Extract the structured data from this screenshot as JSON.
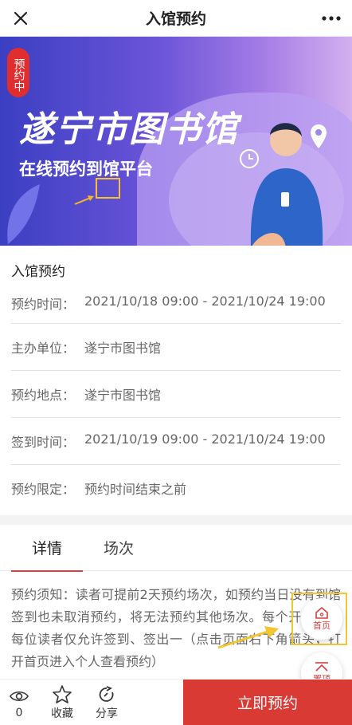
{
  "nav": {
    "title": "入馆预约",
    "close_icon": "close-icon",
    "more_icon": "more-icon"
  },
  "banner": {
    "badge": "预约中",
    "title": "遂宁市图书馆",
    "subtitle": "在线预约到馆平台"
  },
  "info": {
    "heading": "入馆预约",
    "rows": [
      {
        "k": "预约时间：",
        "v": "2021/10/18 09:00 - 2021/10/24 19:00"
      },
      {
        "k": "主办单位：",
        "v": "遂宁市图书馆"
      },
      {
        "k": "预约地点：",
        "v": "遂宁市图书馆"
      },
      {
        "k": "签到时间：",
        "v": "2021/10/19 09:00 - 2021/10/24 19:00"
      },
      {
        "k": "预约限定：",
        "v": "预约时间结束之前"
      }
    ]
  },
  "tabs": [
    {
      "label": "详情"
    },
    {
      "label": "场次"
    }
  ],
  "detail": {
    "text": "预约须知：读者可提前2天预约场次，如预约当日没有到馆签到也未取消预约，将无法预约其他场次。每个开放时段每位读者仅允许签到、签出一（点击页面右下角箭头，打开首页进入个人查看预约）"
  },
  "fab": {
    "home": "首页",
    "top": "置顶"
  },
  "bottom": {
    "views": "0",
    "favorite": "收藏",
    "share": "分享",
    "reserve": "立即预约"
  },
  "colors": {
    "accent": "#d93a33",
    "highlight": "#f3c52e",
    "banner_start": "#3b3fc2"
  }
}
